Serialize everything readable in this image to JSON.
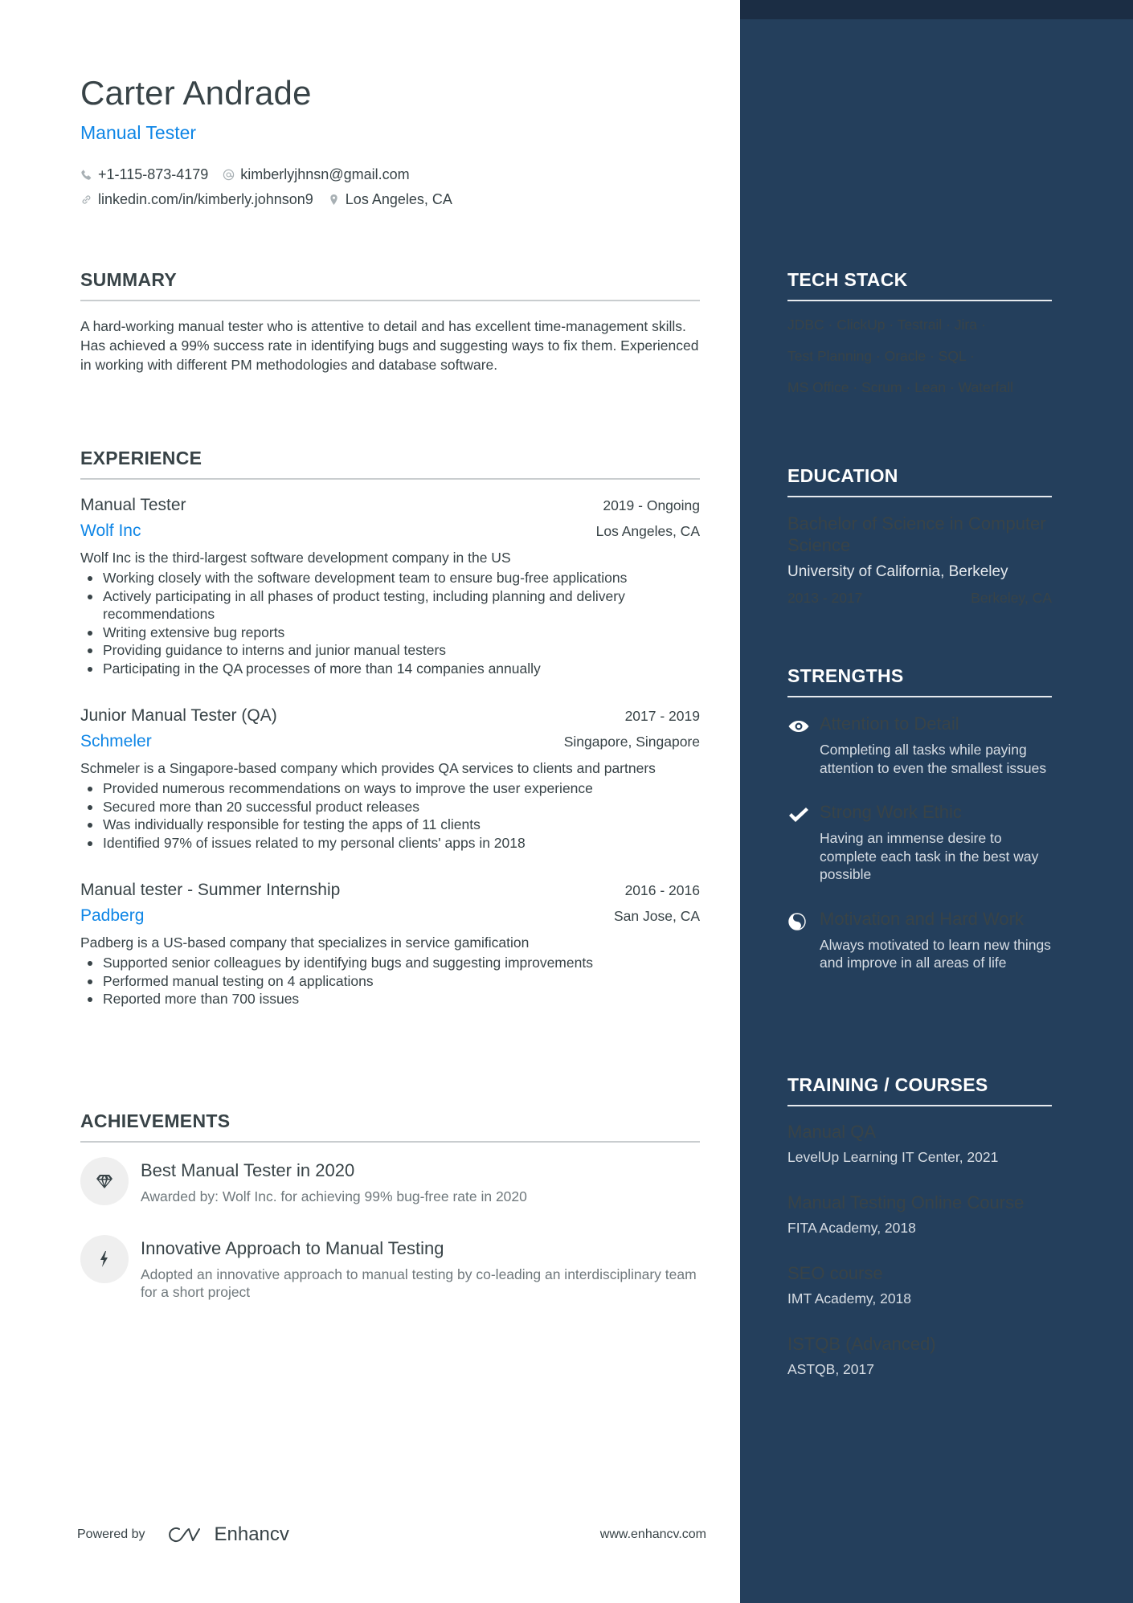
{
  "header": {
    "name": "Carter Andrade",
    "role": "Manual Tester",
    "contacts": {
      "phone": "+1-115-873-4179",
      "email": "kimberlyjhnsn@gmail.com",
      "linkedin": "linkedin.com/in/kimberly.johnson9",
      "location": "Los Angeles, CA"
    }
  },
  "summary": {
    "title": "SUMMARY",
    "text": "A hard-working manual tester who is attentive to detail and has excellent time-management skills. Has achieved a 99% success rate in identifying bugs and suggesting ways to fix them. Experienced in working with different PM methodologies and database software."
  },
  "experience": {
    "title": "EXPERIENCE",
    "jobs": [
      {
        "title": "Manual Tester",
        "dates": "2019 - Ongoing",
        "company": "Wolf Inc",
        "location": "Los Angeles, CA",
        "description": "Wolf Inc is the third-largest software development company in the US",
        "bullets": [
          "Working closely with the software development team to ensure bug-free applications",
          "Actively participating in all phases of product testing, including planning and delivery recommendations",
          "Writing extensive bug reports",
          "Providing guidance to interns and junior manual testers",
          "Participating in the QA processes of more than 14 companies annually"
        ]
      },
      {
        "title": "Junior Manual Tester (QA)",
        "dates": "2017 - 2019",
        "company": "Schmeler",
        "location": "Singapore, Singapore",
        "description": "Schmeler is a Singapore-based company which provides QA services to clients and partners",
        "bullets": [
          "Provided numerous recommendations on ways to improve the user experience",
          "Secured more than 20 successful product releases",
          "Was individually responsible for testing the apps of 11 clients",
          "Identified 97% of issues related to my personal clients' apps in 2018"
        ]
      },
      {
        "title": "Manual tester - Summer Internship",
        "dates": "2016 - 2016",
        "company": "Padberg",
        "location": "San Jose, CA",
        "description": "Padberg is a US-based company that specializes in service gamification",
        "bullets": [
          "Supported senior colleagues by identifying bugs and suggesting improvements",
          "Performed manual testing on 4 applications",
          "Reported more than 700 issues"
        ]
      }
    ]
  },
  "achievements": {
    "title": "ACHIEVEMENTS",
    "items": [
      {
        "icon": "diamond-icon",
        "title": "Best Manual Tester in 2020",
        "description": "Awarded by: Wolf Inc. for achieving 99% bug-free rate in 2020"
      },
      {
        "icon": "lightning-icon",
        "title": "Innovative Approach to Manual Testing",
        "description": "Adopted an innovative approach to manual testing by co-leading an interdisciplinary team for a short project"
      }
    ]
  },
  "footer": {
    "powered_by": "Powered by",
    "brand": "Enhancv",
    "site": "www.enhancv.com"
  },
  "tech_stack": {
    "title": "TECH STACK",
    "lines": [
      "JDBC · ClickUp · Testrail · Jira ·",
      "Test Planning · Oracle · SQL ·",
      "MS Office · Scrum · Lean · Waterfall"
    ]
  },
  "education": {
    "title": "EDUCATION",
    "degree": "Bachelor of Science in Computer Science",
    "school": "University of California, Berkeley",
    "dates": "2013 - 2017",
    "location": "Berkeley, CA"
  },
  "strengths": {
    "title": "STRENGTHS",
    "items": [
      {
        "icon": "eye-icon",
        "title": "Attention to Detail",
        "description": "Completing all tasks while paying attention to even the smallest issues"
      },
      {
        "icon": "checkmark-icon",
        "title": "Strong Work Ethic",
        "description": "Having an immense desire to complete each task in the best way possible"
      },
      {
        "icon": "yin-yang-icon",
        "title": "Motivation and Hard Work",
        "description": "Always motivated to learn new things and improve in all areas of life"
      }
    ]
  },
  "training": {
    "title": "TRAINING / COURSES",
    "items": [
      {
        "title": "Manual QA",
        "subtitle": "LevelUp Learning IT Center, 2021"
      },
      {
        "title": "Manual Testing Online Course",
        "subtitle": "FITA Academy, 2018"
      },
      {
        "title": "SEO course",
        "subtitle": "IMT Academy, 2018"
      },
      {
        "title": "ISTQB (Advanced)",
        "subtitle": "ASTQB, 2017"
      }
    ]
  },
  "colors": {
    "accent": "#0f86e6",
    "sidebar": "#243f5c",
    "sidebar_top": "#1b2d44",
    "text": "#384347"
  }
}
